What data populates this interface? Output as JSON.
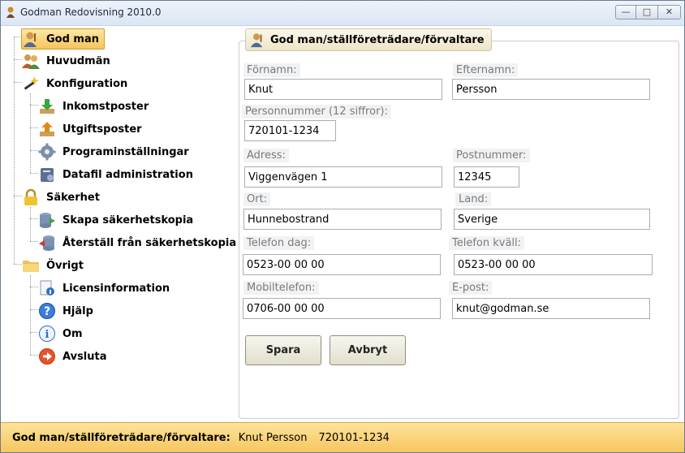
{
  "window": {
    "title": "Godman Redovisning 2010.0",
    "minimize": "—",
    "maximize": "□",
    "close": "✕"
  },
  "sidebar": {
    "items": [
      {
        "label": "God man",
        "icon": "user-icon",
        "selected": true
      },
      {
        "label": "Huvudmän",
        "icon": "users-icon"
      },
      {
        "label": "Konfiguration",
        "icon": "wand-icon"
      },
      {
        "label": "Inkomstposter",
        "icon": "download-icon"
      },
      {
        "label": "Utgiftsposter",
        "icon": "upload-icon"
      },
      {
        "label": "Programinställningar",
        "icon": "gear-icon"
      },
      {
        "label": "Datafil administration",
        "icon": "database-icon"
      },
      {
        "label": "Säkerhet",
        "icon": "lock-icon"
      },
      {
        "label": "Skapa säkerhetskopia",
        "icon": "backup-create-icon"
      },
      {
        "label": "Återställ från säkerhetskopia",
        "icon": "backup-restore-icon"
      },
      {
        "label": "Övrigt",
        "icon": "folder-icon"
      },
      {
        "label": "Licensinformation",
        "icon": "license-icon"
      },
      {
        "label": "Hjälp",
        "icon": "help-icon"
      },
      {
        "label": "Om",
        "icon": "info-icon"
      },
      {
        "label": "Avsluta",
        "icon": "exit-icon"
      }
    ]
  },
  "form": {
    "group_title": "God man/ställföreträdare/förvaltare",
    "fields": {
      "fornamn": {
        "label": "Förnamn:",
        "value": "Knut"
      },
      "efternamn": {
        "label": "Efternamn:",
        "value": "Persson"
      },
      "personnummer": {
        "label": "Personnummer (12 siffror):",
        "value": "720101-1234"
      },
      "adress": {
        "label": "Adress:",
        "value": "Viggenvägen 1"
      },
      "postnummer": {
        "label": "Postnummer:",
        "value": "12345"
      },
      "ort": {
        "label": "Ort:",
        "value": "Hunnebostrand"
      },
      "land": {
        "label": "Land:",
        "value": "Sverige"
      },
      "telefon_dag": {
        "label": "Telefon dag:",
        "value": "0523-00 00 00"
      },
      "telefon_kvall": {
        "label": "Telefon kväll:",
        "value": "0523-00 00 00"
      },
      "mobiltelefon": {
        "label": "Mobiltelefon:",
        "value": "0706-00 00 00"
      },
      "epost": {
        "label": "E-post:",
        "value": "knut@godman.se"
      }
    },
    "save_label": "Spara",
    "cancel_label": "Avbryt"
  },
  "status": {
    "label": "God man/ställföreträdare/förvaltare:",
    "name": "Knut Persson",
    "personnummer": "720101-1234"
  }
}
